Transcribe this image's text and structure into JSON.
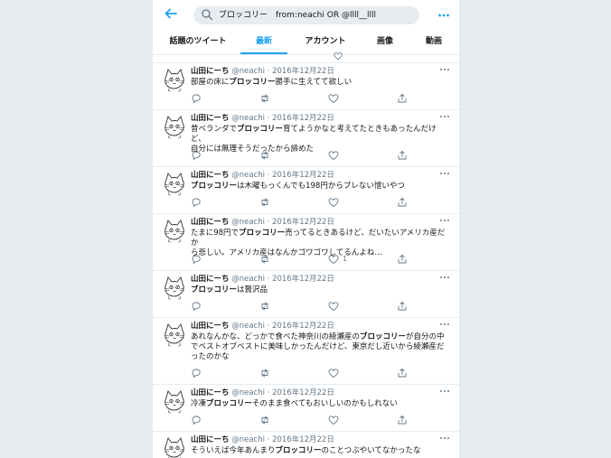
{
  "search": {
    "query": "ブロッコリー　from:neachi OR @llll__llll"
  },
  "tabs": [
    {
      "label": "話題のツイート"
    },
    {
      "label": "最新"
    },
    {
      "label": "アカウント"
    },
    {
      "label": "画像"
    },
    {
      "label": "動画"
    }
  ],
  "tweets": [
    {
      "name": "山田にーち",
      "handle": "@neachi",
      "date": "2016年12月22日",
      "lines": [
        [
          {
            "t": "部屋の床に"
          },
          {
            "b": "ブロッコリー"
          },
          {
            "t": "勝手に生えてて欲しい"
          }
        ]
      ],
      "likes": ""
    },
    {
      "name": "山田にーち",
      "handle": "@neachi",
      "date": "2016年12月22日",
      "lines": [
        [
          {
            "t": "昔ベランダで"
          },
          {
            "b": "ブロッコリー"
          },
          {
            "t": "育てようかなと考えてたときもあったんだけど、"
          }
        ],
        [
          {
            "t": "自分には無理そうだったから諦めた"
          }
        ]
      ],
      "likes": ""
    },
    {
      "name": "山田にーち",
      "handle": "@neachi",
      "date": "2016年12月22日",
      "lines": [
        [
          {
            "b": "ブロッコリー"
          },
          {
            "t": "は木曜もっくんでも198円からブレない憎いやつ"
          }
        ]
      ],
      "likes": ""
    },
    {
      "name": "山田にーち",
      "handle": "@neachi",
      "date": "2016年12月22日",
      "lines": [
        [
          {
            "t": "たまに98円で"
          },
          {
            "b": "ブロッコリー"
          },
          {
            "t": "売ってるときあるけど、だいたいアメリカ産だか"
          }
        ],
        [
          {
            "t": "ら悲しい。アメリカ産はなんかゴワゴワしてるんよね…"
          }
        ]
      ],
      "likes": "1"
    },
    {
      "name": "山田にーち",
      "handle": "@neachi",
      "date": "2016年12月22日",
      "lines": [
        [
          {
            "b": "ブロッコリー"
          },
          {
            "t": "は贅沢品"
          }
        ]
      ],
      "likes": ""
    },
    {
      "name": "山田にーち",
      "handle": "@neachi",
      "date": "2016年12月22日",
      "lines": [
        [
          {
            "t": "あれなんかな、どっかで食べた神奈川の綾瀬産の"
          },
          {
            "b": "ブロッコリー"
          },
          {
            "t": "が自分の中"
          }
        ],
        [
          {
            "t": "でベストオブベストに美味しかったんだけど、東京だし近いから綾瀬産だ"
          }
        ],
        [
          {
            "t": "ったのかな"
          }
        ]
      ],
      "likes": ""
    },
    {
      "name": "山田にーち",
      "handle": "@neachi",
      "date": "2016年12月22日",
      "lines": [
        [
          {
            "t": "冷凍"
          },
          {
            "b": "ブロッコリー"
          },
          {
            "t": "そのまま食べてもおいしいのかもしれない"
          }
        ]
      ],
      "likes": ""
    },
    {
      "name": "山田にーち",
      "handle": "@neachi",
      "date": "2016年12月22日",
      "lines": [
        [
          {
            "t": "そういえば今年あんまり"
          },
          {
            "b": "ブロッコリー"
          },
          {
            "t": "のことつぶやいてなかったな"
          }
        ]
      ],
      "likes": ""
    }
  ],
  "colors": {
    "accent": "#1da1f2",
    "muted": "#657786",
    "divider": "#e6ecf0"
  },
  "icons": [
    "back-arrow-icon",
    "search-icon",
    "more-icon",
    "reply-icon",
    "retweet-icon",
    "like-icon",
    "share-icon",
    "caret-icon",
    "cat-avatar"
  ]
}
